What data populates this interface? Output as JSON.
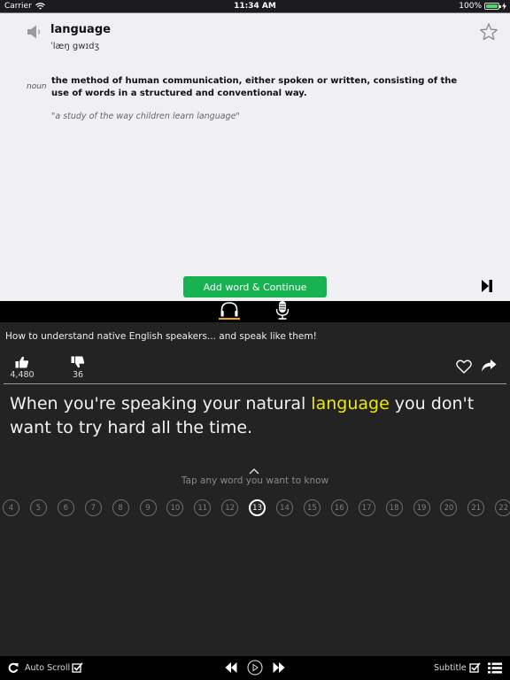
{
  "status_bar": {
    "carrier": "Carrier",
    "time": "11:34 AM",
    "battery": "100%",
    "battery_level": 1.0
  },
  "dictionary": {
    "word": "language",
    "phonetic": "ˈlæŋ gwɪdʒ",
    "part_of_speech": "noun",
    "definition": "the method of human communication, either spoken or written, consisting of the use of words in a structured and conventional way.",
    "example": "\"a study of the way children learn language\"",
    "icons": {
      "audio": "speaker-icon",
      "favorite": "star-icon"
    }
  },
  "actions": {
    "add_word_label": "Add word & Continue",
    "skip_icon": "skip-to-end-icon"
  },
  "mode_tabs": [
    {
      "name": "listen",
      "icon": "headphones-icon",
      "active": true
    },
    {
      "name": "speak",
      "icon": "microphone-icon",
      "active": false
    }
  ],
  "colors": {
    "accent_green": "#17b350",
    "highlight_yellow": "#f0e60f",
    "tab_underline": "#f5a800"
  },
  "video": {
    "title": "How to understand native English speakers...  and speak like them!",
    "likes": "4,480",
    "dislikes": "36"
  },
  "subtitle": {
    "before": "When you're speaking your natural ",
    "highlight": "language",
    "after": " you don't want to try hard all the time."
  },
  "hint": "Tap any word you want to know",
  "pager": {
    "pages": [
      "4",
      "5",
      "6",
      "7",
      "8",
      "9",
      "10",
      "11",
      "12",
      "13",
      "14",
      "15",
      "16",
      "17",
      "18",
      "19",
      "20",
      "21",
      "22"
    ],
    "current": "13"
  },
  "toolbar": {
    "auto_scroll_label": "Auto Scroll",
    "auto_scroll_checked": true,
    "subtitle_label": "Subtitle",
    "subtitle_checked": true
  }
}
